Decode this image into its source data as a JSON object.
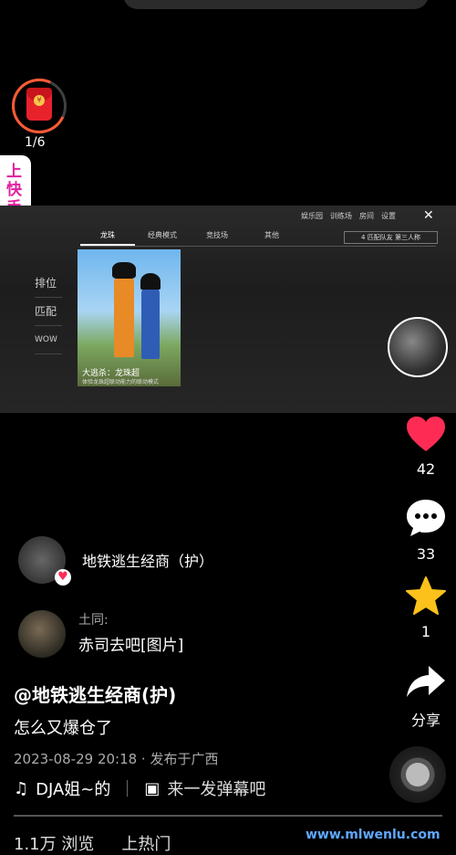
{
  "redpacket": {
    "count": "1/6"
  },
  "side_banner": {
    "label": "上快手看亚运"
  },
  "game": {
    "top_menu": [
      "娱乐园",
      "训练场",
      "房间",
      "设置"
    ],
    "tabs": [
      "龙珠",
      "经典模式",
      "竞技场",
      "其他"
    ],
    "team_select": "4 匹配队友 第三人称",
    "side_menu": [
      "排位",
      "匹配",
      "WOW"
    ],
    "card_title": "大逃杀：龙珠超",
    "card_subtitle": "体验龙珠超联动能力的联动模式"
  },
  "actions": {
    "like_count": "42",
    "comment_count": "33",
    "favorite_count": "1",
    "share_label": "分享"
  },
  "author": {
    "name": "地铁逃生经商（护）"
  },
  "top_comment": {
    "user": "土同:",
    "text": "赤司去吧[图片]"
  },
  "post": {
    "title": "@地铁逃生经商(护)",
    "description": "怎么又爆仓了",
    "meta": "2023-08-29 20:18 · 发布于广西",
    "music": "DJA姐~的",
    "danmaku_placeholder": "来一发弹幕吧"
  },
  "bottom": {
    "views": "1.1万 浏览",
    "hot": "上热门"
  },
  "watermark": "www.mlwenlu.com",
  "colors": {
    "like": "#fe2c55",
    "star": "#fcc21b",
    "accent_pink": "#e020a0"
  }
}
